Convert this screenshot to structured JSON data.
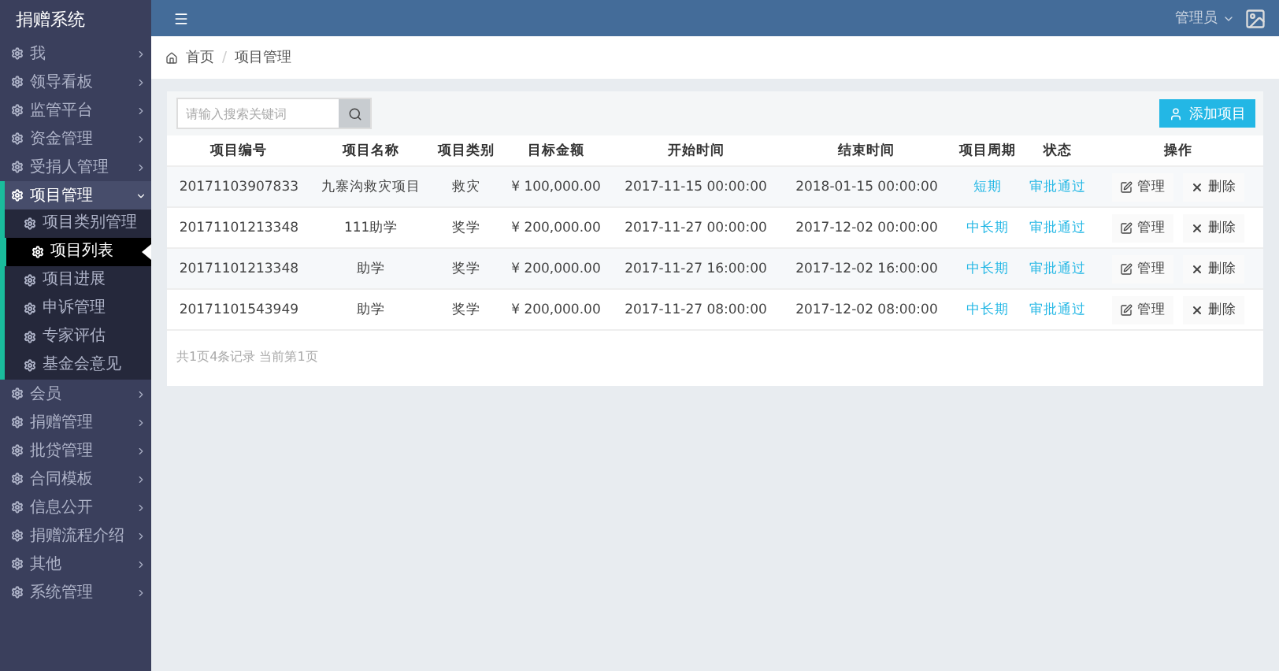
{
  "sidebar": {
    "title": "捐赠系统",
    "items": [
      {
        "label": "我",
        "expanded": false
      },
      {
        "label": "领导看板",
        "expanded": false
      },
      {
        "label": "监管平台",
        "expanded": false
      },
      {
        "label": "资金管理",
        "expanded": false
      },
      {
        "label": "受捐人管理",
        "expanded": false
      },
      {
        "label": "项目管理",
        "expanded": true,
        "children": [
          {
            "label": "项目类别管理",
            "selected": false
          },
          {
            "label": "项目列表",
            "selected": true
          },
          {
            "label": "项目进展",
            "selected": false
          },
          {
            "label": "申诉管理",
            "selected": false
          },
          {
            "label": "专家评估",
            "selected": false
          },
          {
            "label": "基金会意见",
            "selected": false
          }
        ]
      },
      {
        "label": "会员",
        "expanded": false
      },
      {
        "label": "捐赠管理",
        "expanded": false
      },
      {
        "label": "批贷管理",
        "expanded": false
      },
      {
        "label": "合同模板",
        "expanded": false
      },
      {
        "label": "信息公开",
        "expanded": false
      },
      {
        "label": "捐赠流程介绍",
        "expanded": false
      },
      {
        "label": "其他",
        "expanded": false
      },
      {
        "label": "系统管理",
        "expanded": false
      }
    ]
  },
  "topbar": {
    "user": "管理员"
  },
  "breadcrumb": {
    "separator": "/",
    "items": [
      "首页",
      "项目管理"
    ]
  },
  "search": {
    "placeholder": "请输入搜索关键词"
  },
  "add_button": "添加项目",
  "table": {
    "columns": [
      "项目编号",
      "项目名称",
      "项目类别",
      "目标金额",
      "开始时间",
      "结束时间",
      "项目周期",
      "状态",
      "操作"
    ],
    "rows": [
      {
        "id": "20171103907833",
        "name": "九寨沟救灾项目",
        "category": "救灾",
        "amount": "¥ 100,000.00",
        "start": "2017-11-15 00:00:00",
        "end": "2018-01-15 00:00:00",
        "period": "短期",
        "status": "审批通过",
        "edit": "管理",
        "delete": "删除"
      },
      {
        "id": "20171101213348",
        "name": "111助学",
        "category": "奖学",
        "amount": "¥ 200,000.00",
        "start": "2017-11-27 00:00:00",
        "end": "2017-12-02 00:00:00",
        "period": "中长期",
        "status": "审批通过",
        "edit": "管理",
        "delete": "删除"
      },
      {
        "id": "20171101213348",
        "name": "助学",
        "category": "奖学",
        "amount": "¥ 200,000.00",
        "start": "2017-11-27 16:00:00",
        "end": "2017-12-02 16:00:00",
        "period": "中长期",
        "status": "审批通过",
        "edit": "管理",
        "delete": "删除"
      },
      {
        "id": "20171101543949",
        "name": "助学",
        "category": "奖学",
        "amount": "¥ 200,000.00",
        "start": "2017-11-27 08:00:00",
        "end": "2017-12-02 08:00:00",
        "period": "中长期",
        "status": "审批通过",
        "edit": "管理",
        "delete": "删除"
      }
    ]
  },
  "pagination": "共1页4条记录 当前第1页"
}
